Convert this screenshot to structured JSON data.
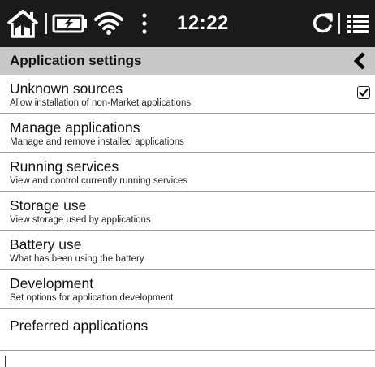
{
  "status_bar": {
    "icons": [
      "home-icon",
      "battery-charging-icon",
      "wifi-icon",
      "more-vertical-icon",
      "refresh-icon",
      "list-menu-icon"
    ],
    "time": "12:22"
  },
  "header": {
    "title": "Application settings",
    "back_icon": "chevron-left-icon"
  },
  "settings": {
    "items": [
      {
        "title": "Unknown sources",
        "subtitle": "Allow installation of non-Market applications",
        "checked": true
      },
      {
        "title": "Manage applications",
        "subtitle": "Manage and remove installed applications"
      },
      {
        "title": "Running services",
        "subtitle": "View and control currently running services"
      },
      {
        "title": "Storage use",
        "subtitle": "View storage used by applications"
      },
      {
        "title": "Battery use",
        "subtitle": "What has been using the battery"
      },
      {
        "title": "Development",
        "subtitle": "Set options for application development"
      },
      {
        "title": "Preferred applications"
      }
    ]
  },
  "colors": {
    "status_bar_bg": "#1a1a1a",
    "header_bg": "#c8c8c8",
    "divider": "#9a9a9a"
  }
}
